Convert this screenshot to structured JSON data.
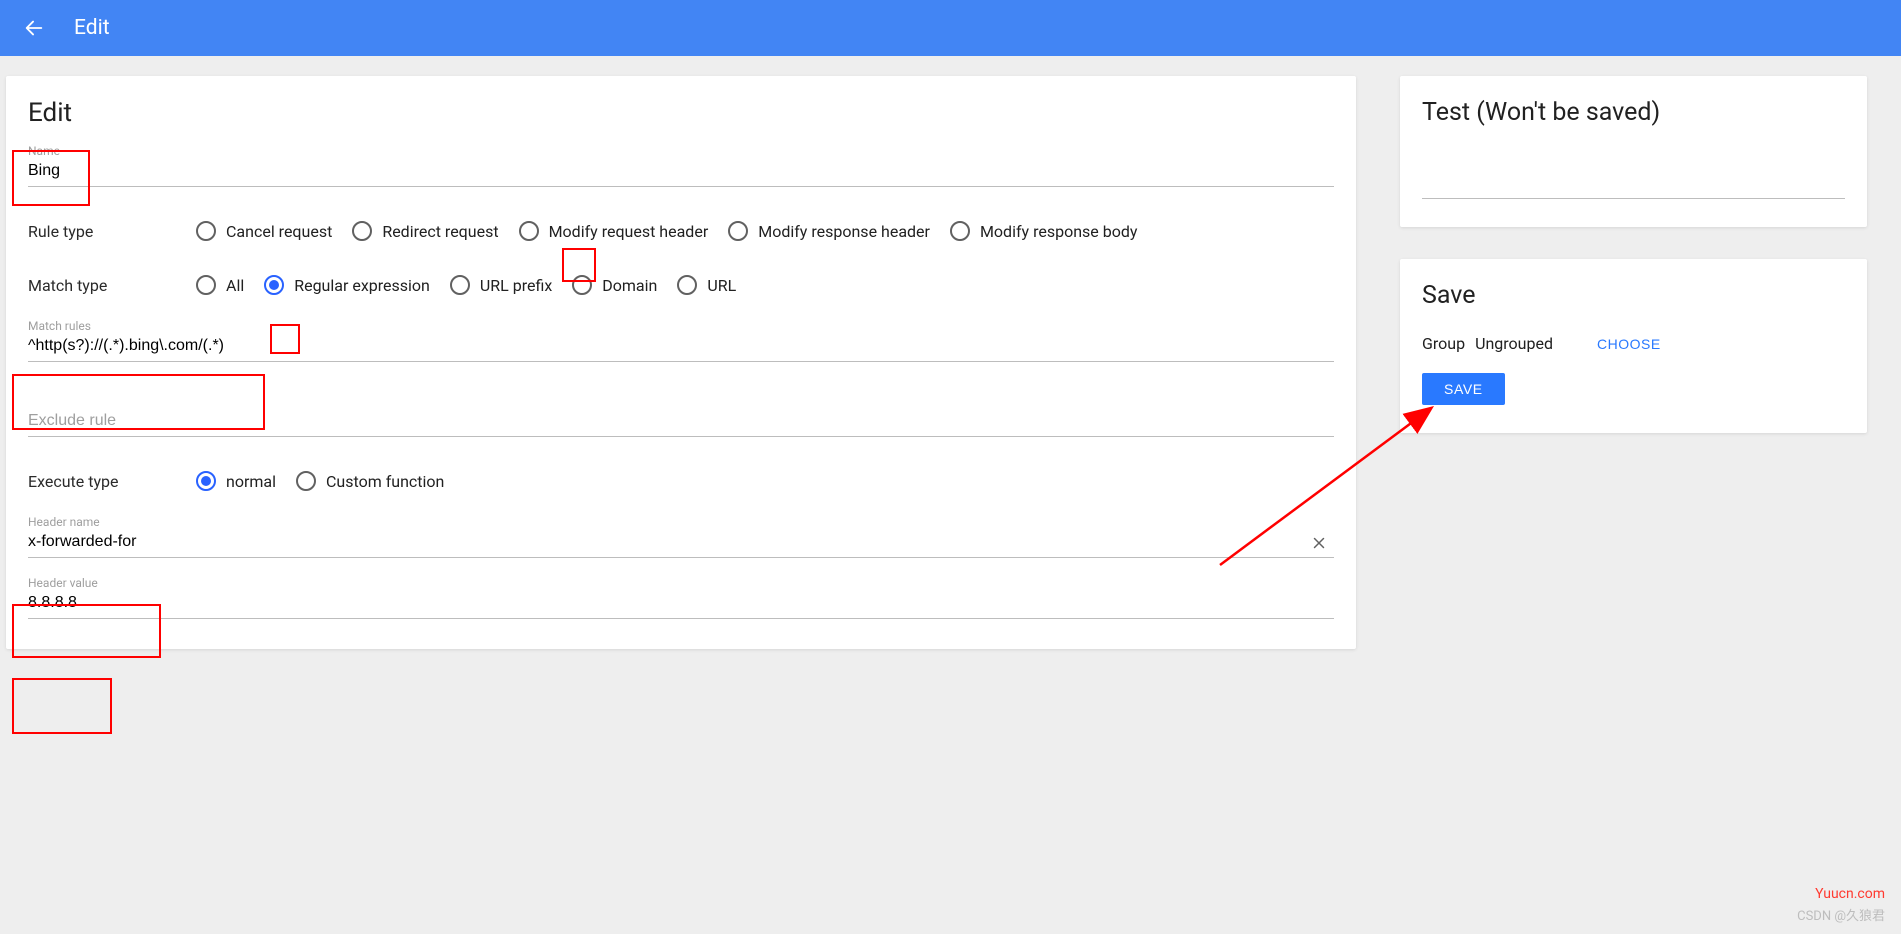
{
  "topbar": {
    "title": "Edit"
  },
  "main": {
    "page_title": "Edit",
    "name_label": "Name",
    "name_value": "Bing",
    "rule_type_label": "Rule type",
    "rule_types": {
      "cancel": "Cancel request",
      "redirect": "Redirect request",
      "mod_req_header": "Modify request header",
      "mod_res_header": "Modify response header",
      "mod_res_body": "Modify response body"
    },
    "match_type_label": "Match type",
    "match_types": {
      "all": "All",
      "regex": "Regular expression",
      "url_prefix": "URL prefix",
      "domain": "Domain",
      "url": "URL"
    },
    "match_rules_label": "Match rules",
    "match_rules_value": "^http(s?)://(.*).bing\\.com/(.*)",
    "exclude_label": "Exclude rule",
    "execute_type_label": "Execute type",
    "execute_types": {
      "normal": "normal",
      "custom": "Custom function"
    },
    "header_name_label": "Header name",
    "header_name_value": "x-forwarded-for",
    "header_value_label": "Header value",
    "header_value_value": "8.8.8.8"
  },
  "test": {
    "title": "Test (Won't be saved)"
  },
  "save": {
    "title": "Save",
    "group_label": "Group",
    "group_value": "Ungrouped",
    "choose": "CHOOSE",
    "save_btn": "SAVE"
  },
  "watermarks": {
    "w1": "Yuucn.com",
    "w2": "CSDN @久狼君"
  }
}
